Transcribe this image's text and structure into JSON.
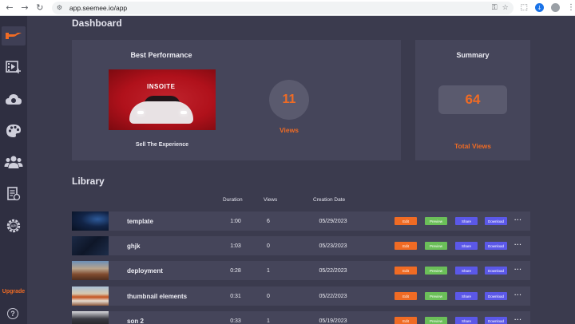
{
  "browser": {
    "url": "app.seemee.io/app",
    "back_icon": "arrow-left-icon",
    "forward_icon": "arrow-right-icon",
    "reload_icon": "reload-icon"
  },
  "sidebar": {
    "items": [
      {
        "name": "home",
        "icon": "logo-icon",
        "active": true
      },
      {
        "name": "videos",
        "icon": "video-add-icon"
      },
      {
        "name": "cloud",
        "icon": "cloud-upload-icon"
      },
      {
        "name": "themes",
        "icon": "palette-icon"
      },
      {
        "name": "users",
        "icon": "users-icon"
      },
      {
        "name": "documents",
        "icon": "document-icon"
      },
      {
        "name": "api",
        "icon": "api-gear-icon"
      }
    ],
    "upgrade_label": "Upgrade",
    "help_label": "?"
  },
  "dashboard": {
    "title": "Dashboard",
    "best": {
      "title": "Best Performance",
      "video_title": "Sell The Experience",
      "thumb_text": "INSOITE",
      "views_count": "11",
      "views_label": "Views"
    },
    "summary": {
      "title": "Summary",
      "total_count": "64",
      "total_label": "Total Views"
    }
  },
  "library": {
    "title": "Library",
    "columns": {
      "duration": "Duration",
      "views": "Views",
      "created": "Creation Date"
    },
    "button_labels": {
      "edit": "Edit",
      "preview": "Preview",
      "share": "Share",
      "download": "Download",
      "more": "···"
    },
    "rows": [
      {
        "name": "template",
        "duration": "1:00",
        "views": "6",
        "date": "05/29/2023"
      },
      {
        "name": "ghjk",
        "duration": "1:03",
        "views": "0",
        "date": "05/23/2023"
      },
      {
        "name": "deployment",
        "duration": "0:28",
        "views": "1",
        "date": "05/22/2023"
      },
      {
        "name": "thumbnail elements",
        "duration": "0:31",
        "views": "0",
        "date": "05/22/2023"
      },
      {
        "name": "son 2",
        "duration": "0:33",
        "views": "1",
        "date": "05/19/2023"
      }
    ]
  },
  "colors": {
    "accent": "#f06b24",
    "background": "#3b3b4e",
    "card": "#45455a",
    "preview": "#6bbf59",
    "share": "#5b58e8"
  }
}
